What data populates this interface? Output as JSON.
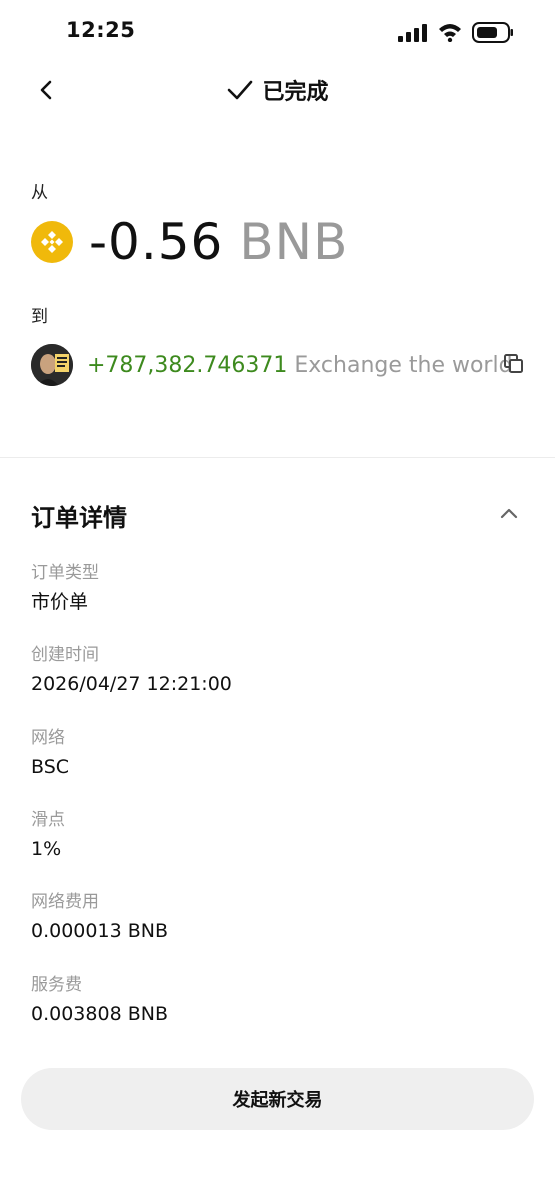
{
  "status_bar": {
    "time": "12:25"
  },
  "header": {
    "title": "已完成",
    "status_icon": "check-icon",
    "back_icon": "chevron-left-icon"
  },
  "transfer": {
    "from_label": "从",
    "from_amount": "-0.56",
    "from_symbol": "BNB",
    "from_icon": "bnb-coin-icon",
    "to_label": "到",
    "to_amount": "+787,382.746371",
    "to_token_name": "Exchange the world",
    "to_icon": "token-avatar"
  },
  "order_details": {
    "title": "订单详情",
    "items": [
      {
        "label": "订单类型",
        "value": "市价单"
      },
      {
        "label": "创建时间",
        "value": "2026/04/27 12:21:00"
      },
      {
        "label": "网络",
        "value": "BSC"
      },
      {
        "label": "滑点",
        "value": "1%"
      },
      {
        "label": "网络费用",
        "value": "0.000013 BNB"
      },
      {
        "label": "服务费",
        "value": "0.003808 BNB"
      }
    ]
  },
  "actions": {
    "new_trade_label": "发起新交易"
  },
  "colors": {
    "positive": "#3d8a1e",
    "muted": "#9a9a9a",
    "bnb_yellow": "#F0B90B",
    "button_bg": "#efefef"
  }
}
